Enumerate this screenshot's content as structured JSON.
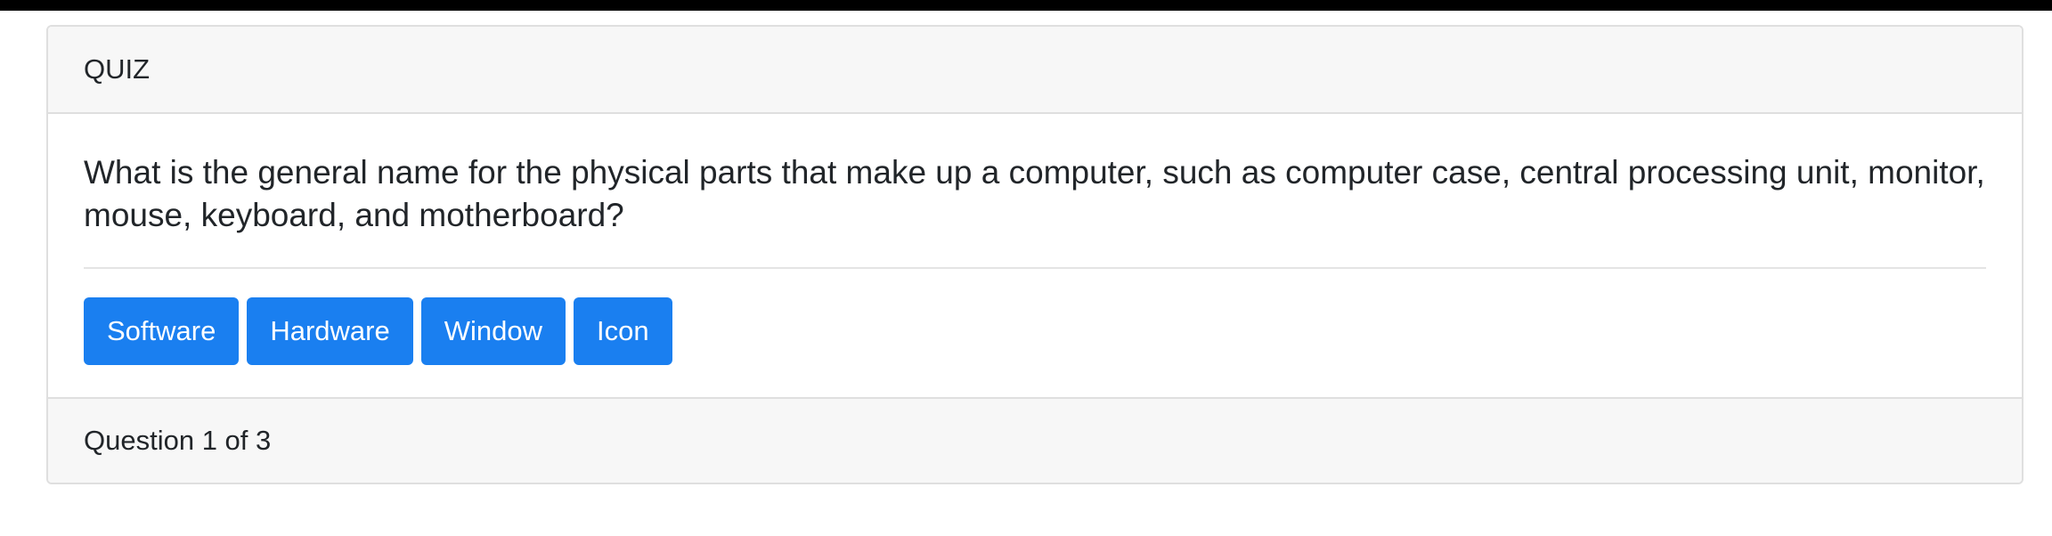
{
  "quiz": {
    "header_title": "QUIZ",
    "question": "What is the general name for the physical parts that make up a computer, such as computer case, central processing unit, monitor, mouse, keyboard, and motherboard?",
    "answers": [
      {
        "label": "Software"
      },
      {
        "label": "Hardware"
      },
      {
        "label": "Window"
      },
      {
        "label": "Icon"
      }
    ],
    "progress_text": "Question 1 of 3"
  },
  "colors": {
    "primary_button": "#1a7ff0",
    "card_header_bg": "#f7f7f7",
    "top_bar": "#000000"
  }
}
